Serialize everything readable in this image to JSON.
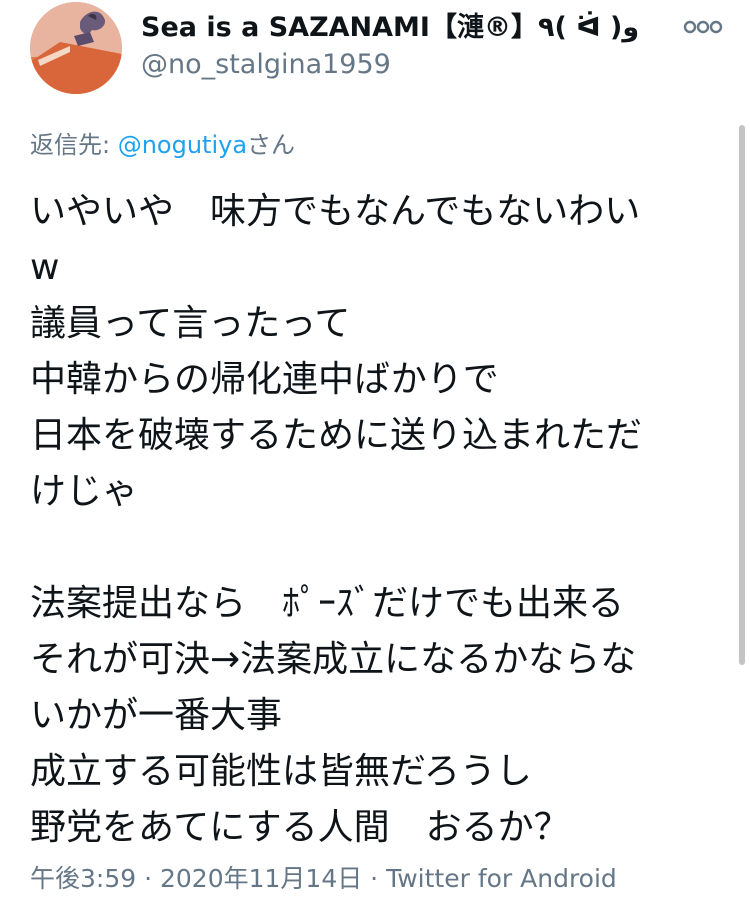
{
  "tweet": {
    "display_name": "Sea is a SAZANAMI【漣®】٩( ᐛ )و",
    "handle": "@no_stalgina1959",
    "reply_prefix": "返信先: ",
    "reply_mention": "@nogutiya",
    "reply_suffix": "さん",
    "body_lines": [
      "いやいや　味方でもなんでもないわい",
      "w",
      "議員って言ったって",
      "中韓からの帰化連中ばかりで",
      "日本を破壊するために送り込まれただ",
      "けじゃ",
      "",
      "法案提出なら　ﾎﾟｰｽﾞだけでも出来る",
      "それが可決→法案成立になるかならな",
      "いかが一番大事",
      "成立する可能性は皆無だろうし",
      "野党をあてにする人間　おるか？"
    ],
    "time": "午後3:59",
    "separator_1": " · ",
    "date": "2020年11月14日",
    "separator_2": " · ",
    "source": "Twitter for Android"
  },
  "icons": {
    "avatar": "avatar-image",
    "more": "more-options-icon"
  },
  "colors": {
    "text": "#0f1419",
    "secondary": "#657786",
    "link": "#1da1f2",
    "background": "#ffffff"
  }
}
